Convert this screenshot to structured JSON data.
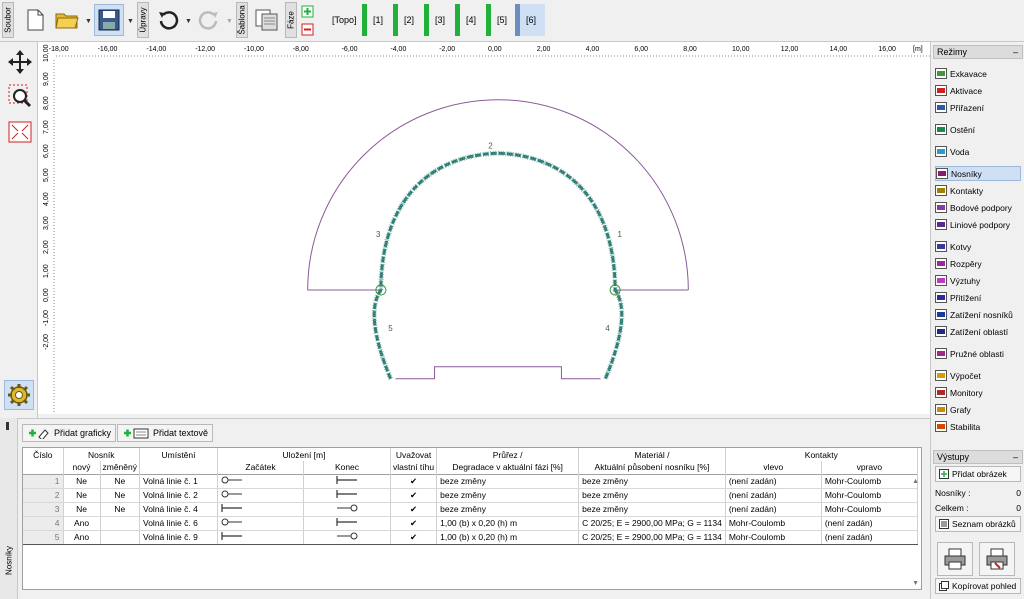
{
  "toolbar": {
    "soubor": "Soubor",
    "upravy": "Úpravy",
    "sablona": "Šablona",
    "faze": "Fáze",
    "topo": "[Topo]",
    "phases": [
      "[1]",
      "[2]",
      "[3]",
      "[4]",
      "[5]",
      "[6]"
    ]
  },
  "canvas": {
    "unit": "[m]",
    "x_ticks": [
      "-18,00",
      "-16,00",
      "-14,00",
      "-12,00",
      "-10,00",
      "-8,00",
      "-6,00",
      "-4,00",
      "-2,00",
      "0,00",
      "2,00",
      "4,00",
      "6,00",
      "8,00",
      "10,00",
      "12,00",
      "14,00",
      "16,00"
    ],
    "y_ticks": [
      "11,00",
      "10,00",
      "9,00",
      "8,00",
      "7,00",
      "6,00",
      "5,00",
      "4,00",
      "3,00",
      "2,00",
      "1,00",
      "0,00",
      "-1,00",
      "-2,00"
    ],
    "beam_labels": [
      "1",
      "2",
      "3",
      "4",
      "5"
    ]
  },
  "bottom": {
    "tab": "Nosníky",
    "add_graphic": "Přidat graficky",
    "add_text": "Přidat textově",
    "headers": {
      "cislo": "Číslo",
      "nosnik": "Nosník",
      "novy": "nový",
      "zmeneny": "změněný",
      "umisteni": "Umístění",
      "ulozeni": "Uložení [m]",
      "zacatek": "Začátek",
      "konec": "Konec",
      "uvazovat": "Uvažovat",
      "vlastni": "vlastní tíhu",
      "prurez": "Průřez /",
      "degradace": "Degradace v aktuální fázi [%]",
      "material": "Materiál /",
      "aktualni": "Aktuální působení nosníku [%]",
      "kontakty": "Kontakty",
      "vlevo": "vlevo",
      "vpravo": "vpravo"
    },
    "rows": [
      {
        "num": "1",
        "novy": "Ne",
        "zmeneny": "Ne",
        "umisteni": "Volná linie č. 1",
        "check": "✔",
        "prurez": "beze změny",
        "material": "beze změny",
        "vlevo": "(není zadán)",
        "vpravo": "Mohr-Coulomb"
      },
      {
        "num": "2",
        "novy": "Ne",
        "zmeneny": "Ne",
        "umisteni": "Volná linie č. 2",
        "check": "✔",
        "prurez": "beze změny",
        "material": "beze změny",
        "vlevo": "(není zadán)",
        "vpravo": "Mohr-Coulomb"
      },
      {
        "num": "3",
        "novy": "Ne",
        "zmeneny": "Ne",
        "umisteni": "Volná linie č. 4",
        "check": "✔",
        "prurez": "beze změny",
        "material": "beze změny",
        "vlevo": "(není zadán)",
        "vpravo": "Mohr-Coulomb"
      },
      {
        "num": "4",
        "novy": "Ano",
        "zmeneny": "",
        "umisteni": "Volná linie č. 6",
        "check": "✔",
        "prurez": "1,00 (b) x 0,20 (h) m",
        "material": "C 20/25; E = 2900,00 MPa; G = 1134",
        "vlevo": "Mohr-Coulomb",
        "vpravo": "(není zadán)"
      },
      {
        "num": "5",
        "novy": "Ano",
        "zmeneny": "",
        "umisteni": "Volná linie č. 9",
        "check": "✔",
        "prurez": "1,00 (b) x 0,20 (h) m",
        "material": "C 20/25; E = 2900,00 MPa; G = 1134",
        "vlevo": "Mohr-Coulomb",
        "vpravo": "(není zadán)"
      }
    ]
  },
  "right": {
    "rezimy": "Režimy",
    "items": [
      {
        "label": "Exkavace",
        "color": "#3a9a3a"
      },
      {
        "label": "Aktivace",
        "color": "#d02020"
      },
      {
        "label": "Přiřazení",
        "color": "#2a5ab0"
      },
      {
        "label": "Ostění",
        "color": "#1a8a4a"
      },
      {
        "label": "Voda",
        "color": "#2a9ad0"
      },
      {
        "label": "Nosníky",
        "color": "#8a1a6a"
      },
      {
        "label": "Kontakty",
        "color": "#a08000"
      },
      {
        "label": "Bodové podpory",
        "color": "#8a3a9a"
      },
      {
        "label": "Liniové podpory",
        "color": "#5a2a8a"
      },
      {
        "label": "Kotvy",
        "color": "#3a3a9a"
      },
      {
        "label": "Rozpěry",
        "color": "#9a2a9a"
      },
      {
        "label": "Výztuhy",
        "color": "#c03ac0"
      },
      {
        "label": "Přitížení",
        "color": "#2a2a9a"
      },
      {
        "label": "Zatížení nosníků",
        "color": "#1a3aa0"
      },
      {
        "label": "Zatížení oblastí",
        "color": "#1a2a8a"
      },
      {
        "label": "Pružné oblasti",
        "color": "#a02a8a"
      },
      {
        "label": "Výpočet",
        "color": "#d0a000"
      },
      {
        "label": "Monitory",
        "color": "#b02a2a"
      },
      {
        "label": "Grafy",
        "color": "#d08a00"
      },
      {
        "label": "Stabilita",
        "color": "#d04a00"
      }
    ],
    "vystupy": "Výstupy",
    "pridat_obrazek": "Přidat obrázek",
    "nosniky_label": "Nosníky :",
    "nosniky_val": "0",
    "celkem_label": "Celkem :",
    "celkem_val": "0",
    "seznam": "Seznam obrázků",
    "kopirovat": "Kopírovat pohled"
  }
}
